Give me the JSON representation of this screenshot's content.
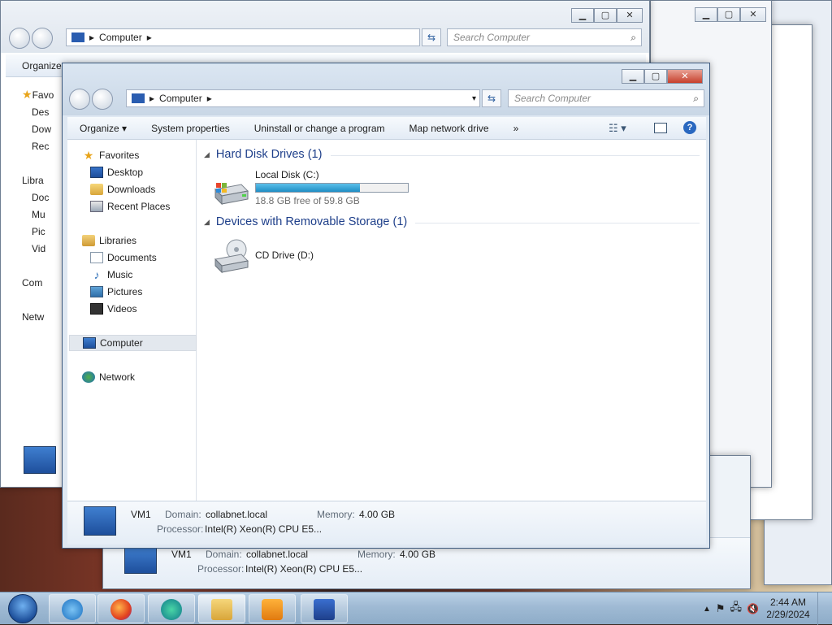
{
  "main_window": {
    "address": "Computer",
    "search_placeholder": "Search Computer",
    "toolbar": {
      "organize": "Organize ▾",
      "system_properties": "System properties",
      "uninstall": "Uninstall or change a program",
      "map_drive": "Map network drive",
      "more": "»"
    },
    "nav": {
      "favorites": "Favorites",
      "desktop": "Desktop",
      "downloads": "Downloads",
      "recent": "Recent Places",
      "libraries": "Libraries",
      "documents": "Documents",
      "music": "Music",
      "pictures": "Pictures",
      "videos": "Videos",
      "computer": "Computer",
      "network": "Network"
    },
    "sections": {
      "hdd": "Hard Disk Drives (1)",
      "removable": "Devices with Removable Storage (1)"
    },
    "drives": {
      "c_name": "Local Disk (C:)",
      "c_free": "18.8 GB free of 59.8 GB",
      "c_used_fraction": 0.686,
      "d_name": "CD Drive (D:)"
    },
    "details": {
      "name": "VM1",
      "domain_label": "Domain:",
      "domain": "collabnet.local",
      "memory_label": "Memory:",
      "memory": "4.00 GB",
      "processor_label": "Processor:",
      "processor": "Intel(R) Xeon(R) CPU E5..."
    }
  },
  "back_window": {
    "address": "Computer",
    "search_placeholder": "Search Computer",
    "organize": "Organize",
    "nav_fragments": [
      "Favo",
      "Des",
      "Dow",
      "Rec",
      "Libra",
      "Doc",
      "Mu",
      "Pic",
      "Vid",
      "Com",
      "Netw"
    ],
    "details": {
      "name": "VM1",
      "domain_label": "Domain:",
      "domain": "collabnet.local",
      "memory_label": "Memory:",
      "memory": "4.00 GB",
      "processor_label": "Processor:",
      "processor": "Intel(R) Xeon(R) CPU E5..."
    }
  },
  "taskbar": {
    "time": "2:44 AM",
    "date": "2/29/2024"
  }
}
